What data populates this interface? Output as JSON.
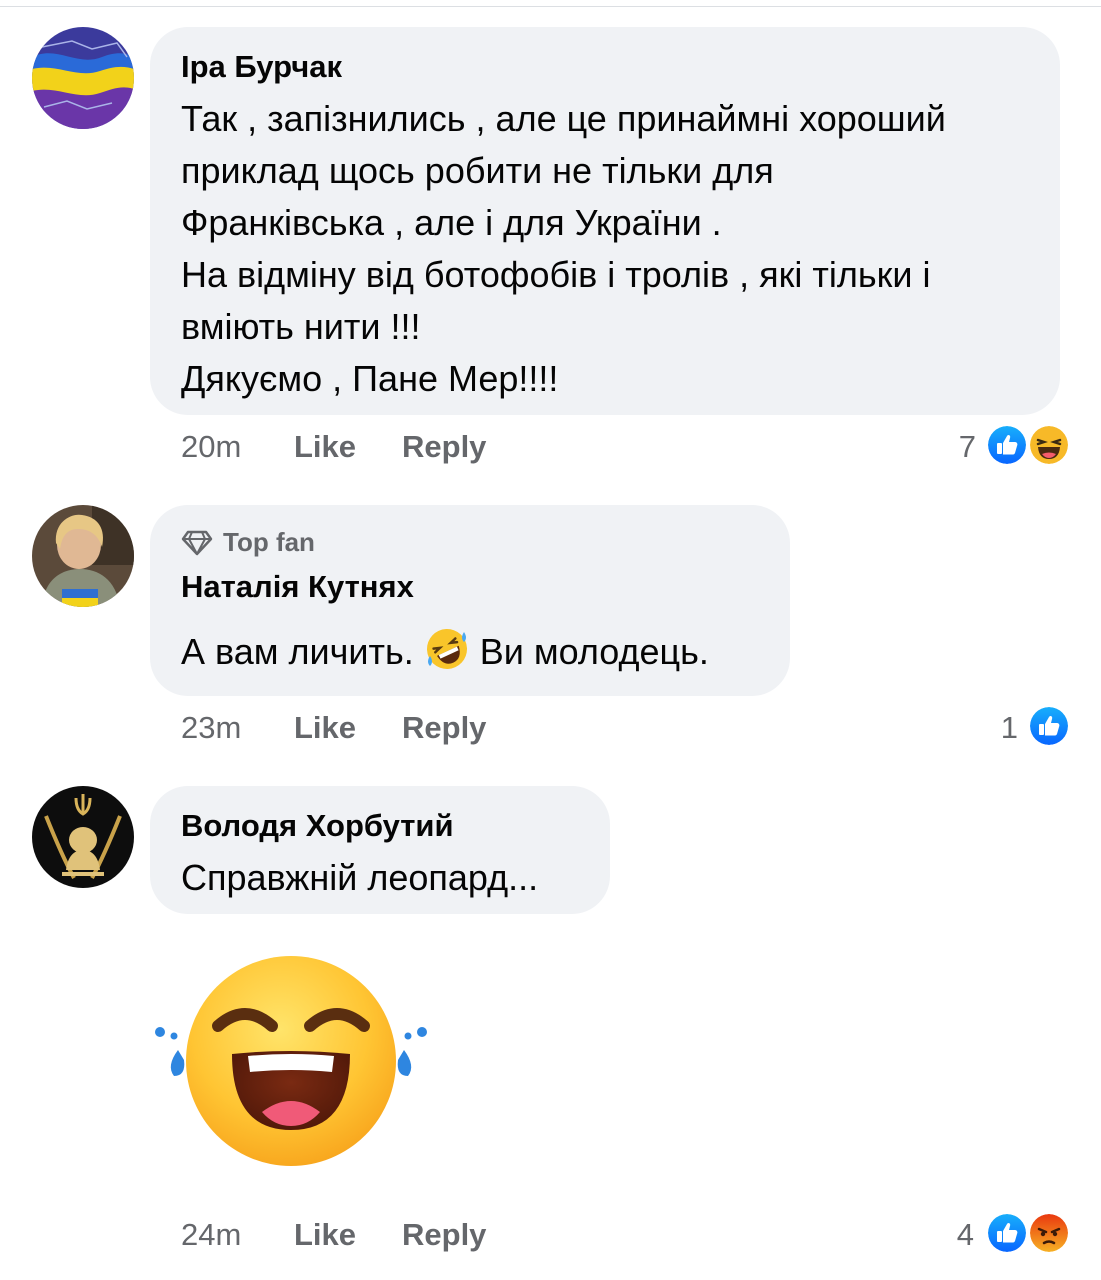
{
  "comments": [
    {
      "author": "Іра Бурчак",
      "lines": [
        "Так , запізнились , але це принаймні хороший",
        "приклад щось робити не тільки для",
        "Франківська , але і для України .",
        "На відміну від ботофобів і тролів , які тільки і",
        "вміють нити !!!",
        "Дякуємо , Пане Мер!!!!"
      ],
      "time": "20m",
      "like": "Like",
      "reply": "Reply",
      "reaction_count": "7",
      "reactions": [
        "like-icon",
        "haha-icon"
      ]
    },
    {
      "badge": "Top fan",
      "author": "Наталія Кутнях",
      "text_before": "А вам личить.",
      "emoji": "rofl-emoji",
      "text_after": "Ви молодець.",
      "time": "23m",
      "like": "Like",
      "reply": "Reply",
      "reaction_count": "1",
      "reactions": [
        "like-icon"
      ]
    },
    {
      "author": "Володя Хорбутий",
      "text": "Справжній леопард...",
      "sticker": "laughing-tears-sticker",
      "time": "24m",
      "like": "Like",
      "reply": "Reply",
      "reaction_count": "4",
      "reactions": [
        "like-icon",
        "angry-icon"
      ]
    }
  ],
  "colors": {
    "bubble": "#f0f2f5",
    "meta_text": "#65676b",
    "like_blue": "#1877f2",
    "haha_yellow": "#f7b928",
    "angry_red": "#e9710f"
  }
}
